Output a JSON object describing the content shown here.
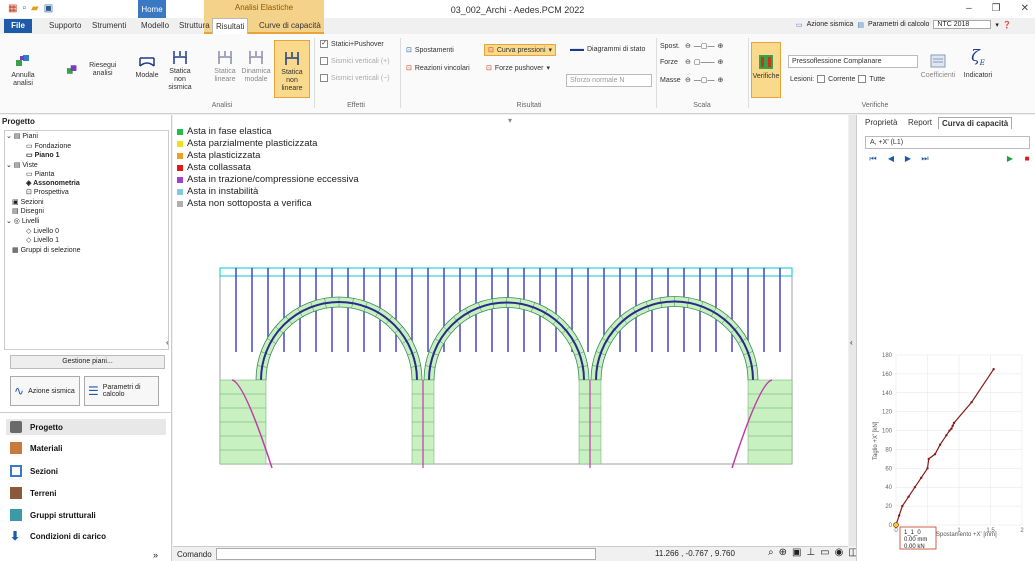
{
  "window": {
    "title": "03_002_Archi - Aedes.PCM 2022"
  },
  "header": {
    "home_label": "Home",
    "context_group": "Analisi Elastiche"
  },
  "tabs": [
    "File",
    "Supporto",
    "Strumenti",
    "Modello",
    "Struttura",
    "Risultati",
    "Curve di capacità"
  ],
  "topright": {
    "seismic": "Azione sismica",
    "params": "Parametri di calcolo",
    "norm": "NTC 2018"
  },
  "ribbon": {
    "annulla": "Annulla analisi",
    "riesegui": "Riesegui analisi",
    "modale": "Modale",
    "statica_ns": "Statica non sismica",
    "statica_lin": "Statica lineare",
    "dinamica_mod": "Dinamica modale",
    "statica_nl": "Statica non lineare",
    "group_analisi": "Analisi",
    "chk_statici": "Statici+Pushover",
    "chk_sismici_pos": "Sismici verticali (+)",
    "chk_sismici_neg": "Sismici verticali (−)",
    "group_effetti": "Effetti",
    "spostamenti": "Spostamenti",
    "reazioni": "Reazioni vincolari",
    "curva_pressioni": "Curva pressioni",
    "forze_pushover": "Forze pushover",
    "diagrammi": "Diagrammi di stato",
    "sforzo": "Sforzo normale N",
    "group_risultati": "Risultati",
    "spost": "Spost.",
    "forze": "Forze",
    "masse": "Masse",
    "group_scala": "Scala",
    "verifiche": "Verifiche",
    "pressoflessione": "Pressoflessione Complanare",
    "lesioni": "Lesioni:",
    "corrente": "Corrente",
    "tutte": "Tutte",
    "coefficienti": "Coefficienti",
    "indicatori": "Indicatori",
    "group_verifiche": "Verifiche"
  },
  "sidebar": {
    "title": "Progetto",
    "tree": [
      {
        "label": "Piani",
        "level": 0
      },
      {
        "label": "Fondazione",
        "level": 2
      },
      {
        "label": "Piano 1",
        "level": 2,
        "bold": true
      },
      {
        "label": "Viste",
        "level": 0
      },
      {
        "label": "Pianta",
        "level": 2
      },
      {
        "label": "Assonometria",
        "level": 2,
        "bold": true
      },
      {
        "label": "Prospettiva",
        "level": 2
      },
      {
        "label": "Sezioni",
        "level": 1
      },
      {
        "label": "Disegni",
        "level": 1
      },
      {
        "label": "Livelli",
        "level": 0
      },
      {
        "label": "Livello 0",
        "level": 2
      },
      {
        "label": "Livello 1",
        "level": 2
      },
      {
        "label": "Gruppi di selezione",
        "level": 1
      }
    ],
    "gestione": "Gestione piani...",
    "azione_sismica": "Azione sismica",
    "parametri": "Parametri di calcolo",
    "nav": [
      "Progetto",
      "Materiali",
      "Sezioni",
      "Terreni",
      "Gruppi strutturali",
      "Condizioni di carico"
    ]
  },
  "legend": [
    {
      "label": "Asta in fase elastica",
      "color": "#22c04a"
    },
    {
      "label": "Asta parzialmente plasticizzata",
      "color": "#f0e020"
    },
    {
      "label": "Asta plasticizzata",
      "color": "#f0a020"
    },
    {
      "label": "Asta collassata",
      "color": "#e01818"
    },
    {
      "label": "Asta in trazione/compressione eccessiva",
      "color": "#a040d0"
    },
    {
      "label": "Asta in instabilità",
      "color": "#80c8e8"
    },
    {
      "label": "Asta non sottoposta a verifica",
      "color": "#b0b0b0"
    }
  ],
  "command": {
    "label": "Comando",
    "coords": "11.266 , -0.767 , 9.760"
  },
  "right": {
    "tabs": [
      "Proprietà",
      "Report",
      "Curva di capacità"
    ],
    "dropdown": "A, +X' (L1)",
    "chart_yaxis_label": "Taglio +X' [kN]",
    "chart_xaxis_label": "Spostamento +X' [mm]",
    "tooltip": [
      "1_1_0",
      "0.00 mm",
      "0.00 kN"
    ]
  },
  "chart_data": {
    "type": "line",
    "xlabel": "Spostamento +X' [mm]",
    "ylabel": "Taglio +X' [kN]",
    "xlim": [
      0,
      2
    ],
    "ylim": [
      0,
      180
    ],
    "xticks": [
      0,
      0.5,
      1,
      1.5,
      2
    ],
    "yticks": [
      0,
      20,
      40,
      60,
      80,
      100,
      120,
      140,
      160,
      180
    ],
    "series": [
      {
        "x": [
          0,
          0.05,
          0.1,
          0.2,
          0.3,
          0.4,
          0.5,
          0.52,
          0.62,
          0.7,
          0.8,
          0.85,
          0.88,
          0.9,
          0.92,
          1.2,
          1.55
        ],
        "y": [
          0,
          10,
          20,
          30,
          40,
          50,
          60,
          70,
          75,
          85,
          95,
          100,
          102,
          105,
          108,
          130,
          165
        ]
      }
    ]
  }
}
